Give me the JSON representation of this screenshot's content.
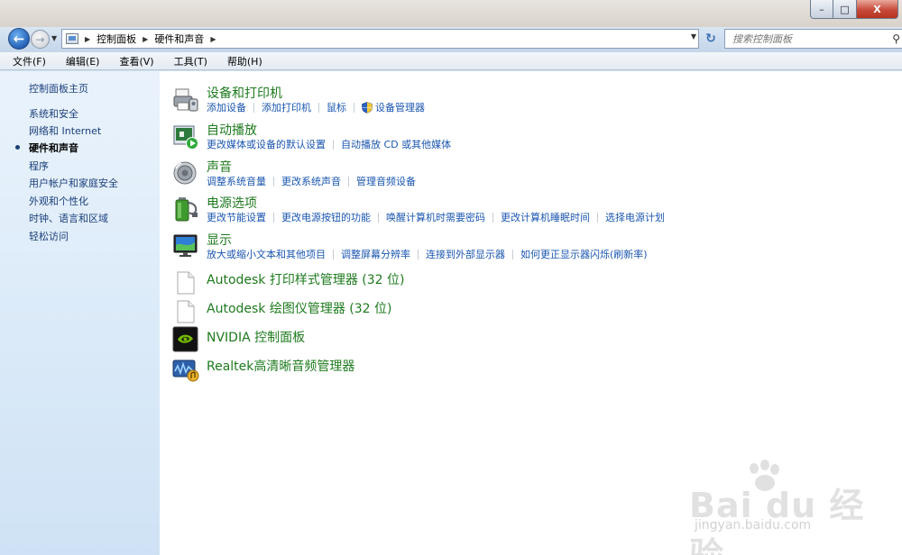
{
  "window": {
    "minimize": "–",
    "maximize": "□",
    "close": "X"
  },
  "address": {
    "breadcrumbs": [
      "控制面板",
      "硬件和声音"
    ],
    "search_placeholder": "搜索控制面板"
  },
  "menubar": {
    "items": [
      "文件(F)",
      "编辑(E)",
      "查看(V)",
      "工具(T)",
      "帮助(H)"
    ]
  },
  "left_nav": {
    "home": "控制面板主页",
    "items": [
      "系统和安全",
      "网络和 Internet",
      "硬件和声音",
      "程序",
      "用户帐户和家庭安全",
      "外观和个性化",
      "时钟、语言和区域",
      "轻松访问"
    ],
    "current_index": 2
  },
  "categories": [
    {
      "title": "设备和打印机",
      "icon": "printer-icon",
      "links": [
        "添加设备",
        "添加打印机",
        "鼠标",
        "设备管理器"
      ]
    },
    {
      "title": "自动播放",
      "icon": "autoplay-icon",
      "links": [
        "更改媒体或设备的默认设置",
        "自动播放 CD 或其他媒体"
      ]
    },
    {
      "title": "声音",
      "icon": "speaker-icon",
      "links": [
        "调整系统音量",
        "更改系统声音",
        "管理音频设备"
      ]
    },
    {
      "title": "电源选项",
      "icon": "battery-icon",
      "links": [
        "更改节能设置",
        "更改电源按钮的功能",
        "唤醒计算机时需要密码",
        "更改计算机睡眠时间",
        "选择电源计划"
      ]
    },
    {
      "title": "显示",
      "icon": "monitor-icon",
      "links": [
        "放大或缩小文本和其他项目",
        "调整屏幕分辨率",
        "连接到外部显示器",
        "如何更正显示器闪烁(刷新率)"
      ]
    }
  ],
  "programs": [
    {
      "title": "Autodesk 打印样式管理器 (32 位)",
      "icon": "document-icon"
    },
    {
      "title": "Autodesk 绘图仪管理器 (32 位)",
      "icon": "document-icon"
    },
    {
      "title": "NVIDIA 控制面板",
      "icon": "nvidia-icon"
    },
    {
      "title": "Realtek高清晰音频管理器",
      "icon": "realtek-icon"
    }
  ],
  "watermark": {
    "brand": "Bai du 经验",
    "url": "jingyan.baidu.com"
  },
  "colors": {
    "category_title": "#1e7a1e",
    "link": "#1a56b0",
    "nav_link": "#1a3f7a"
  }
}
